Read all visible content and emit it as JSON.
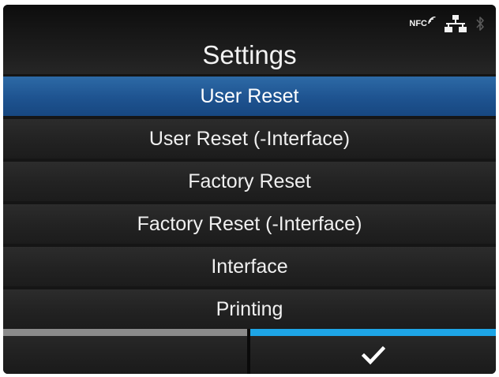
{
  "status_bar": {
    "nfc_label": "NFC",
    "icons": [
      "nfc-icon",
      "network-icon",
      "bluetooth-icon"
    ]
  },
  "header": {
    "title": "Settings"
  },
  "menu": {
    "items": [
      {
        "label": "User Reset",
        "selected": true
      },
      {
        "label": "User Reset (-Interface)",
        "selected": false
      },
      {
        "label": "Factory Reset",
        "selected": false
      },
      {
        "label": "Factory Reset (-Interface)",
        "selected": false
      },
      {
        "label": "Interface",
        "selected": false
      },
      {
        "label": "Printing",
        "selected": false
      }
    ]
  },
  "softkeys": {
    "left": {
      "icon": "",
      "bar_color": "#8b8b8b"
    },
    "right": {
      "icon": "check-icon",
      "bar_color": "#1ea5e6"
    }
  },
  "colors": {
    "selected_item": "#1e5390",
    "background": "#151515",
    "accent": "#1ea5e6"
  }
}
